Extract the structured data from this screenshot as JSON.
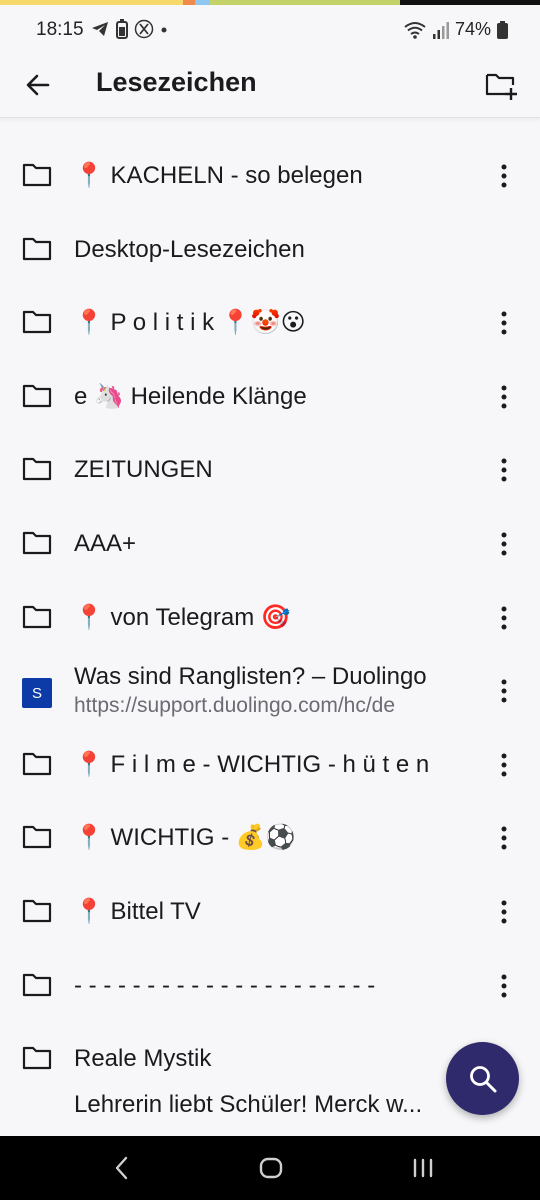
{
  "colors": {
    "accent_bar": [
      "#f7d86b",
      "#f08a4b",
      "#8ec8f0",
      "#c3d36a",
      "#111111"
    ],
    "fab": "#2f2a6c",
    "favicon": "#0c3aa6"
  },
  "status": {
    "time": "18:15",
    "battery": "74%",
    "icons": [
      "telegram-icon",
      "battery-saver-icon",
      "x-icon",
      "dot-icon",
      "wifi-icon",
      "signal-icon",
      "battery-icon"
    ]
  },
  "header": {
    "title": "Lesezeichen",
    "back_icon": "arrow-left-icon",
    "new_folder_icon": "folder-add-icon"
  },
  "items": [
    {
      "type": "folder",
      "label": "📍 KACHELN - so belegen",
      "menu": true
    },
    {
      "type": "folder",
      "label": "Desktop-Lesezeichen",
      "menu": false
    },
    {
      "type": "folder",
      "label": "📍  P o l i t i k 📍🤡😮",
      "menu": true
    },
    {
      "type": "folder",
      "label": "e 🦄 Heilende Klänge",
      "menu": true
    },
    {
      "type": "folder",
      "label": "ZEITUNGEN",
      "menu": true
    },
    {
      "type": "folder",
      "label": "AAA+",
      "menu": true
    },
    {
      "type": "folder",
      "label": "📍 von Telegram 🎯",
      "menu": true
    },
    {
      "type": "bookmark",
      "favicon_letter": "S",
      "label": "Was sind Ranglisten? – Duolingo",
      "url": "https://support.duolingo.com/hc/de",
      "menu": true
    },
    {
      "type": "folder",
      "label": "📍 F i l m e - WICHTIG - h ü t e n",
      "menu": true
    },
    {
      "type": "folder",
      "label": "📍 WICHTIG - 💰⚽",
      "menu": true
    },
    {
      "type": "folder",
      "label": "📍 Bittel TV",
      "menu": true
    },
    {
      "type": "folder",
      "label": "- - - - - - - - - - - - - - - - - - - - -",
      "menu": true
    },
    {
      "type": "folder",
      "label": "Reale Mystik",
      "menu": false
    },
    {
      "type": "bookmark_partial",
      "label": "Lehrerin liebt Schüler! Merck w...",
      "menu": false
    }
  ],
  "fab": {
    "icon": "search-icon"
  },
  "navbar": {
    "back": "nav-back-icon",
    "home": "nav-home-icon",
    "recents": "nav-recents-icon"
  }
}
